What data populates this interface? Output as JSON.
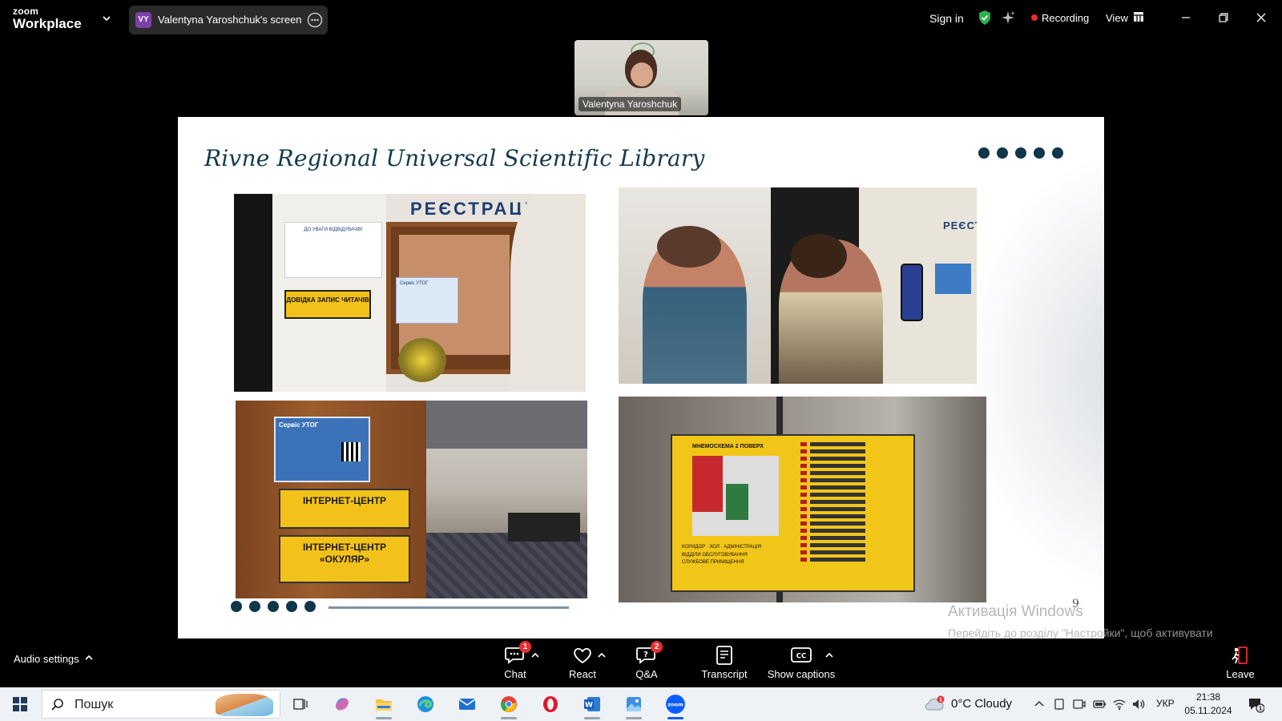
{
  "zoom": {
    "brand_top": "zoom",
    "brand_bottom": "Workplace",
    "share": {
      "initials": "VY",
      "label": "Valentyna Yaroshchuk's screen"
    },
    "sign_in": "Sign in",
    "recording": "Recording",
    "view": "View",
    "participant_name": "Valentyna Yaroshchuk"
  },
  "slide": {
    "title": "Rivne Regional Universal Scientific Library",
    "page_number": "9",
    "photo1": {
      "sign": "РЕЄСТРАЦІ",
      "notice": "ДО УВАГИ ВІДВІДУВАЧІВ!",
      "plate": "ДОВІДКА ЗАПИС ЧИТАЧІВ",
      "poster": "Сервіс УТОГ"
    },
    "photo2": {
      "sign": "РЕЄСТР"
    },
    "photo3": {
      "poster": "Сервіс УТОГ",
      "plate1": "ІНТЕРНЕТ-ЦЕНТР",
      "plate2_line1": "ІНТЕРНЕТ-ЦЕНТР",
      "plate2_line2": "«ОКУЛЯР»"
    },
    "photo4": {
      "board_title": "МНЕМОСХЕМА 2 ПОВЕРХ",
      "legend_corridor": "КОРИДОР",
      "legend_hall": "ХОЛ",
      "legend_admin": "АДМІНІСТРАЦІЯ",
      "legend_service": "ВІДДІЛИ ОБСЛУГОВУВАННЯ",
      "legend_staff": "СЛУЖБОВЕ ПРИМІЩЕННЯ"
    }
  },
  "watermark": {
    "title": "Активація Windows",
    "subtitle": "Перейдіть до розділу \"Настройки\", щоб активувати Windows."
  },
  "controls": {
    "audio_settings": "Audio settings",
    "chat": {
      "label": "Chat",
      "badge": "1"
    },
    "react": {
      "label": "React"
    },
    "qa": {
      "label": "Q&A",
      "badge": "2"
    },
    "transcript": {
      "label": "Transcript"
    },
    "captions": {
      "label": "Show captions"
    },
    "leave": {
      "label": "Leave"
    }
  },
  "taskbar": {
    "search_placeholder": "Пошук",
    "weather": "0°C  Cloudy",
    "weather_badge": "1",
    "language": "УКР",
    "time": "21:38",
    "date": "05.11.2024",
    "notification_badge": "1",
    "apps": [
      "task-view",
      "copilot",
      "file-explorer",
      "edge",
      "mail",
      "chrome",
      "opera",
      "word",
      "photos",
      "zoom"
    ]
  },
  "colors": {
    "slide_title": "#123a4d",
    "slide_dots": "#10364a",
    "record_dot": "#e8302f",
    "badge": "#e8302f",
    "taskbar_bg": "#eef1f5",
    "shield": "#2bb24c"
  }
}
